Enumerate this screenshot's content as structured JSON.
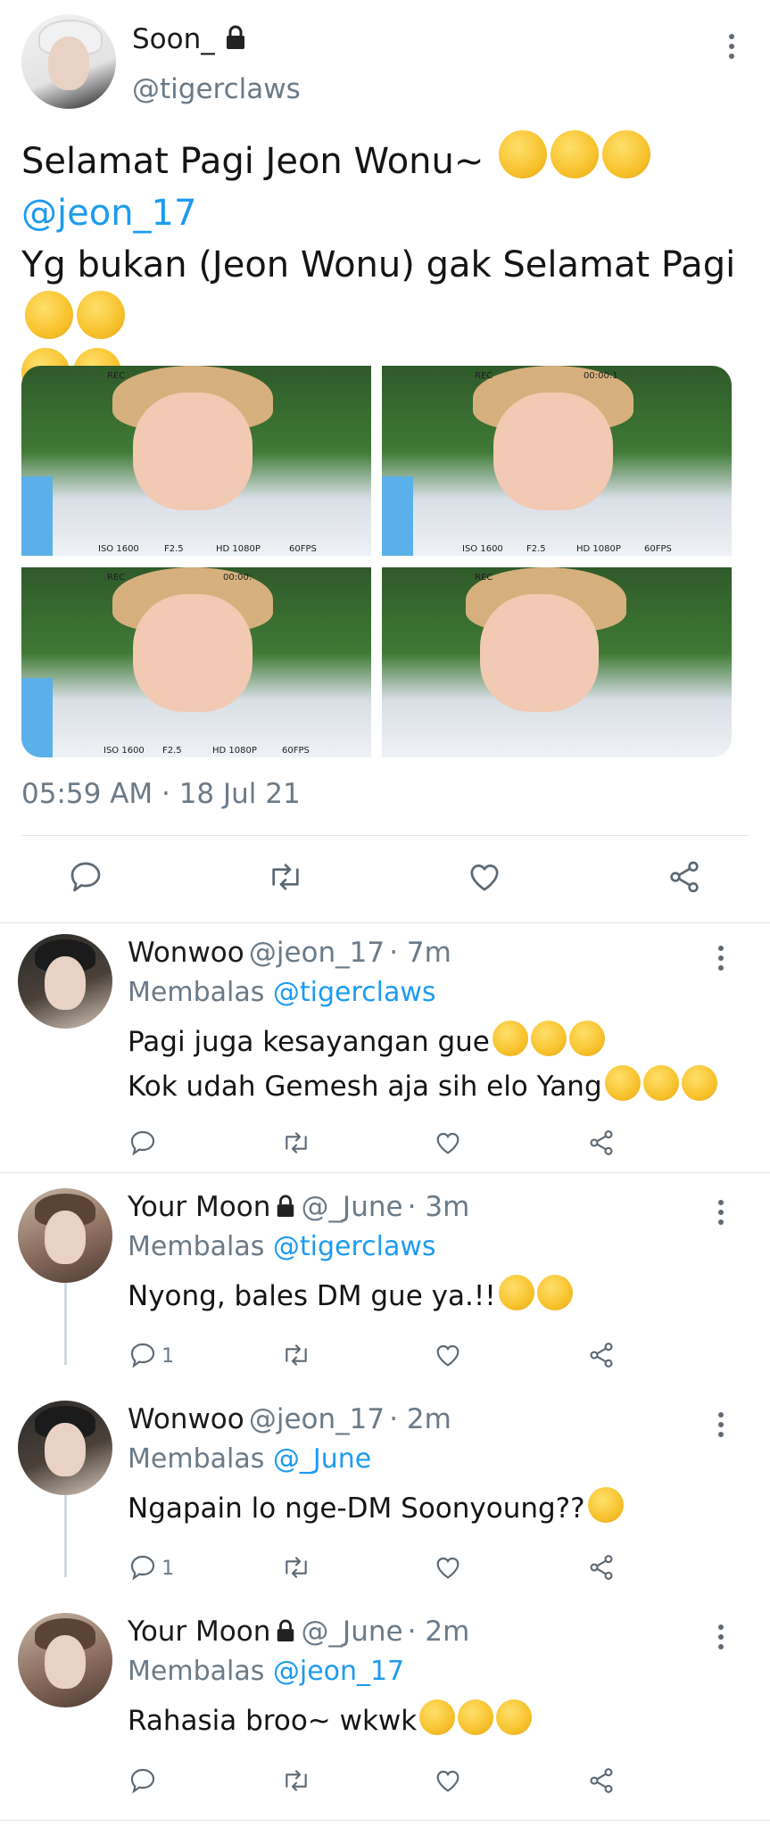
{
  "main_tweet": {
    "author_name": "Soon_",
    "author_handle": "@tigerclaws",
    "text_line1": "Selamat Pagi Jeon Wonu~",
    "mention": "@jeon_17",
    "text_line3": "Yg bukan (Jeon Wonu) gak Selamat Pagi",
    "timestamp": "05:59 AM · 18 Jul 21",
    "photos": [
      {
        "rec": "REC",
        "iso": "ISO 1600",
        "f": "F2.5",
        "hd": "HD 1080P",
        "fps": "60FPS",
        "time": ""
      },
      {
        "rec": "REC",
        "iso": "ISO 1600",
        "f": "F2.5",
        "hd": "HD 1080P",
        "fps": "60FPS",
        "time": "00:00:1"
      },
      {
        "rec": "REC",
        "iso": "ISO 1600",
        "f": "F2.5",
        "hd": "HD 1080P",
        "fps": "60FPS",
        "time": "00:00:"
      },
      {
        "rec": "REC",
        "iso": "",
        "f": "",
        "hd": "",
        "fps": "",
        "time": ""
      }
    ]
  },
  "replies": [
    {
      "name": "Wonwoo",
      "handle": "@jeon_17",
      "time": "· 7m",
      "replying_label": "Membalas",
      "replying_to": "@tigerclaws",
      "line1": "Pagi juga kesayangan gue",
      "line2": "Kok udah Gemesh aja sih elo Yang",
      "reply_count": ""
    },
    {
      "name": "Your Moon",
      "handle": "@_June",
      "time": "· 3m",
      "replying_label": "Membalas",
      "replying_to": "@tigerclaws",
      "line1": "Nyong, bales DM gue ya.!!",
      "reply_count": "1"
    },
    {
      "name": "Wonwoo",
      "handle": "@jeon_17",
      "time": "· 2m",
      "replying_label": "Membalas",
      "replying_to": "@_June",
      "line1": "Ngapain lo nge-DM Soonyoung??",
      "reply_count": "1"
    },
    {
      "name": "Your Moon",
      "handle": "@_June",
      "time": "· 2m",
      "replying_label": "Membalas",
      "replying_to": "@jeon_17",
      "line1": "Rahasia broo~ wkwk",
      "reply_count": ""
    }
  ],
  "icons": {
    "reply": "reply-icon",
    "retweet": "retweet-icon",
    "like": "like-icon",
    "share": "share-icon",
    "more": "more-icon",
    "lock": "lock-icon"
  },
  "colors": {
    "mention": "#1d9bf0",
    "secondary_text": "#6b7a87",
    "divider": "#e1e6ea"
  }
}
